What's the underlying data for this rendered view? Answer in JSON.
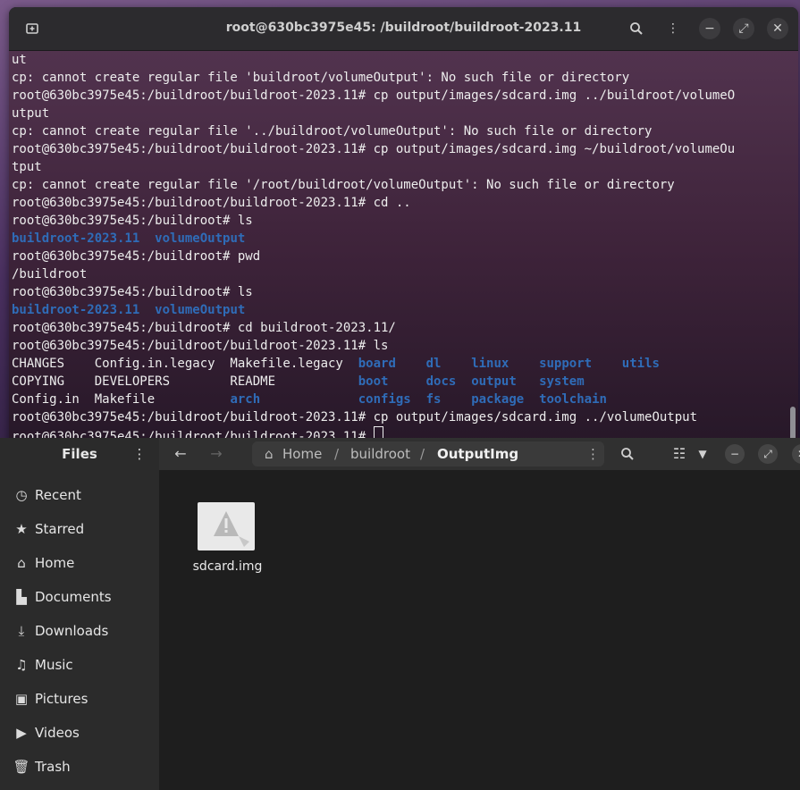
{
  "terminal": {
    "title": "root@630bc3975e45: /buildroot/buildroot-2023.11",
    "lines": [
      [
        {
          "t": "ut"
        }
      ],
      [
        {
          "t": "cp: cannot create regular file 'buildroot/volumeOutput': No such file or directory"
        }
      ],
      [
        {
          "t": "root@630bc3975e45:/buildroot/buildroot-2023.11# cp output/images/sdcard.img ../buildroot/volumeO"
        }
      ],
      [
        {
          "t": "utput"
        }
      ],
      [
        {
          "t": "cp: cannot create regular file '../buildroot/volumeOutput': No such file or directory"
        }
      ],
      [
        {
          "t": "root@630bc3975e45:/buildroot/buildroot-2023.11# cp output/images/sdcard.img ~/buildroot/volumeOu"
        }
      ],
      [
        {
          "t": "tput"
        }
      ],
      [
        {
          "t": "cp: cannot create regular file '/root/buildroot/volumeOutput': No such file or directory"
        }
      ],
      [
        {
          "t": "root@630bc3975e45:/buildroot/buildroot-2023.11# cd .."
        }
      ],
      [
        {
          "t": "root@630bc3975e45:/buildroot# ls"
        }
      ],
      [
        {
          "t": "buildroot-2023.11",
          "c": "blue"
        },
        {
          "t": "  "
        },
        {
          "t": "volumeOutput",
          "c": "blue"
        }
      ],
      [
        {
          "t": "root@630bc3975e45:/buildroot# pwd"
        }
      ],
      [
        {
          "t": "/buildroot"
        }
      ],
      [
        {
          "t": "root@630bc3975e45:/buildroot# ls"
        }
      ],
      [
        {
          "t": "buildroot-2023.11",
          "c": "blue"
        },
        {
          "t": "  "
        },
        {
          "t": "volumeOutput",
          "c": "blue"
        }
      ],
      [
        {
          "t": "root@630bc3975e45:/buildroot# cd buildroot-2023.11/"
        }
      ],
      [
        {
          "t": "root@630bc3975e45:/buildroot/buildroot-2023.11# ls"
        }
      ],
      [
        {
          "t": "CHANGES    Config.in.legacy  Makefile.legacy  "
        },
        {
          "t": "board",
          "c": "blue"
        },
        {
          "t": "    "
        },
        {
          "t": "dl",
          "c": "blue"
        },
        {
          "t": "    "
        },
        {
          "t": "linux",
          "c": "blue"
        },
        {
          "t": "    "
        },
        {
          "t": "support",
          "c": "blue"
        },
        {
          "t": "    "
        },
        {
          "t": "utils",
          "c": "blue"
        }
      ],
      [
        {
          "t": "COPYING    DEVELOPERS        README           "
        },
        {
          "t": "boot",
          "c": "blue"
        },
        {
          "t": "     "
        },
        {
          "t": "docs",
          "c": "blue"
        },
        {
          "t": "  "
        },
        {
          "t": "output",
          "c": "blue"
        },
        {
          "t": "   "
        },
        {
          "t": "system",
          "c": "blue"
        }
      ],
      [
        {
          "t": "Config.in  Makefile          "
        },
        {
          "t": "arch",
          "c": "blue"
        },
        {
          "t": "             "
        },
        {
          "t": "configs",
          "c": "blue"
        },
        {
          "t": "  "
        },
        {
          "t": "fs",
          "c": "blue"
        },
        {
          "t": "    "
        },
        {
          "t": "package",
          "c": "blue"
        },
        {
          "t": "  "
        },
        {
          "t": "toolchain",
          "c": "blue"
        }
      ],
      [
        {
          "t": "root@630bc3975e45:/buildroot/buildroot-2023.11# cp output/images/sdcard.img ../volumeOutput"
        }
      ],
      [
        {
          "t": "root@630bc3975e45:/buildroot/buildroot-2023.11# "
        },
        {
          "cursor": true
        }
      ]
    ]
  },
  "files": {
    "sidebar_title": "Files",
    "sidebar_items": [
      {
        "label": "Recent",
        "icon": "clock-icon"
      },
      {
        "label": "Starred",
        "icon": "star-icon"
      },
      {
        "label": "Home",
        "icon": "home-icon"
      },
      {
        "label": "Documents",
        "icon": "document-icon"
      },
      {
        "label": "Downloads",
        "icon": "download-icon"
      },
      {
        "label": "Music",
        "icon": "music-icon"
      },
      {
        "label": "Pictures",
        "icon": "picture-icon"
      },
      {
        "label": "Videos",
        "icon": "video-icon"
      },
      {
        "label": "Trash",
        "icon": "trash-icon"
      }
    ],
    "breadcrumb": [
      "Home",
      "buildroot",
      "OutputImg"
    ],
    "items": [
      {
        "name": "sdcard.img",
        "icon": "warning-file-icon"
      }
    ]
  },
  "colors": {
    "ls_directory": "#2f6cb8",
    "terminal_text": "#ededed"
  }
}
